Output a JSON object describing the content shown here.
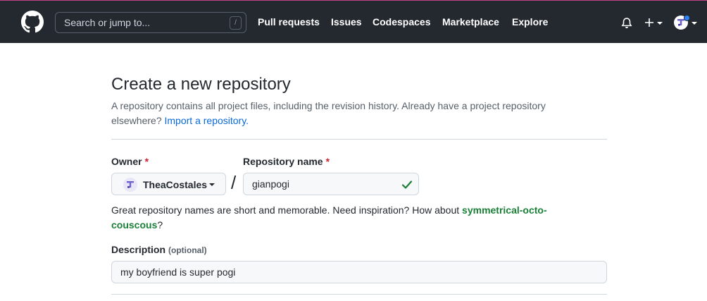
{
  "header": {
    "search_placeholder": "Search or jump to...",
    "search_shortcut": "/",
    "nav": [
      "Pull requests",
      "Issues",
      "Codespaces",
      "Marketplace",
      "Explore"
    ],
    "create_label": "+"
  },
  "page": {
    "title": "Create a new repository",
    "description": "A repository contains all project files, including the revision history. Already have a project repository elsewhere?",
    "import_link": "Import a repository."
  },
  "form": {
    "owner_label": "Owner",
    "required_mark": "*",
    "owner_value": "TheaCostales",
    "separator": "/",
    "repo_label": "Repository name",
    "repo_value": "gianpogi",
    "hint_text": "Great repository names are short and memorable. Need inspiration? How about",
    "suggestion": "symmetrical-octo-couscous",
    "hint_end": "?",
    "description_label": "Description",
    "optional_label": "(optional)",
    "description_value": "my boyfriend is super pogi"
  },
  "colors": {
    "header_bg": "#24292f",
    "link": "#0969da",
    "success": "#1a7f37",
    "required": "#cf222e"
  }
}
